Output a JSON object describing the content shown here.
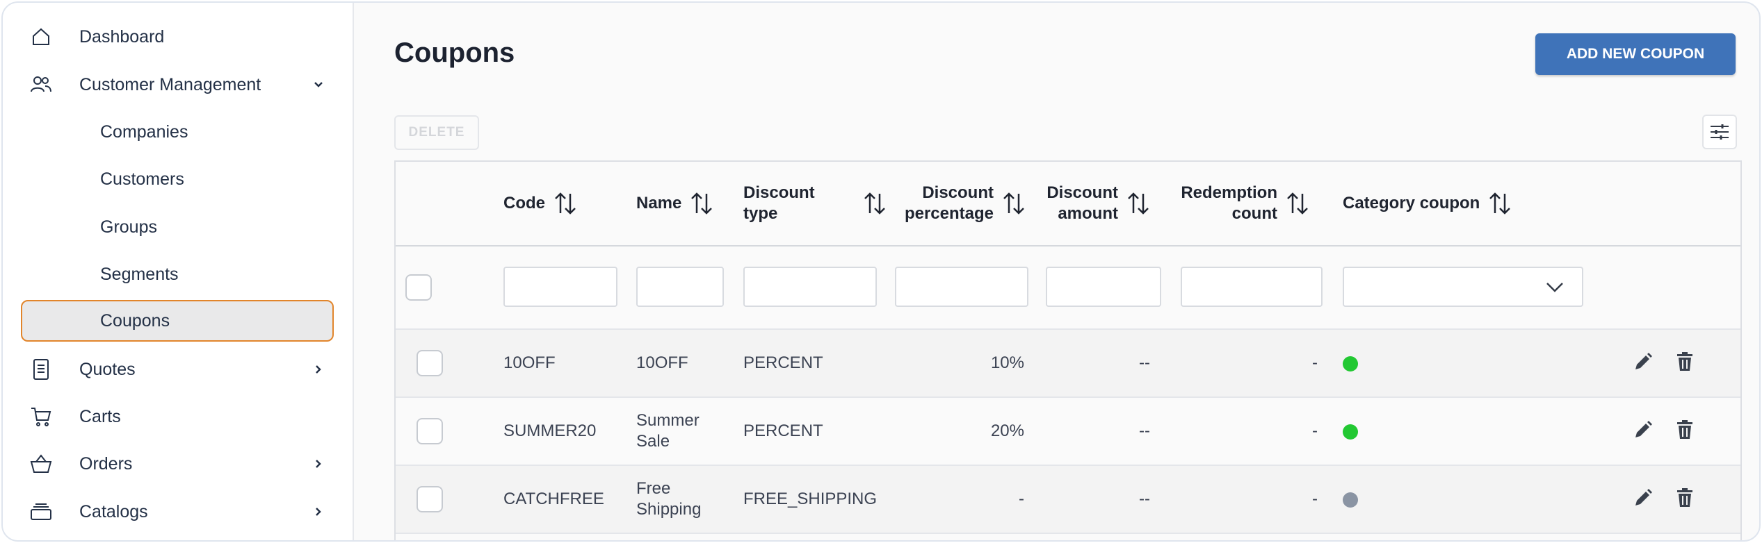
{
  "sidebar": {
    "items": [
      {
        "label": "Dashboard",
        "icon": "home-icon"
      },
      {
        "label": "Customer Management",
        "icon": "users-icon",
        "expanded": true
      },
      {
        "label": "Companies"
      },
      {
        "label": "Customers"
      },
      {
        "label": "Groups"
      },
      {
        "label": "Segments"
      },
      {
        "label": "Coupons",
        "active": true
      },
      {
        "label": "Quotes",
        "icon": "document-icon"
      },
      {
        "label": "Carts",
        "icon": "cart-icon"
      },
      {
        "label": "Orders",
        "icon": "basket-icon"
      },
      {
        "label": "Catalogs",
        "icon": "stack-icon"
      }
    ]
  },
  "header": {
    "title": "Coupons",
    "add_label": "ADD NEW COUPON"
  },
  "toolbar": {
    "delete_label": "DELETE"
  },
  "table": {
    "columns": [
      {
        "line1": "Code",
        "line2": ""
      },
      {
        "line1": "Name",
        "line2": ""
      },
      {
        "line1": "Discount",
        "line2": "type"
      },
      {
        "line1": "Discount",
        "line2": "percentage"
      },
      {
        "line1": "Discount",
        "line2": "amount"
      },
      {
        "line1": "Redemption",
        "line2": "count"
      },
      {
        "line1": "Category coupon",
        "line2": ""
      }
    ],
    "rows": [
      {
        "code": "10OFF",
        "name1": "10OFF",
        "name2": "",
        "type": "PERCENT",
        "percentage": "10%",
        "amount": "--",
        "redemptions": "-",
        "status_color": "#22c832"
      },
      {
        "code": "SUMMER20",
        "name1": "Summer",
        "name2": "Sale",
        "type": "PERCENT",
        "percentage": "20%",
        "amount": "--",
        "redemptions": "-",
        "status_color": "#22c832"
      },
      {
        "code": "CATCHFREE",
        "name1": "Free",
        "name2": "Shipping",
        "type": "FREE_SHIPPING",
        "percentage": "-",
        "amount": "--",
        "redemptions": "-",
        "status_color": "#8a94a3"
      }
    ]
  },
  "colors": {
    "primary": "#3f73b9",
    "active_border": "#e2852b",
    "active_status": "#22c832",
    "inactive_status": "#8a94a3"
  }
}
